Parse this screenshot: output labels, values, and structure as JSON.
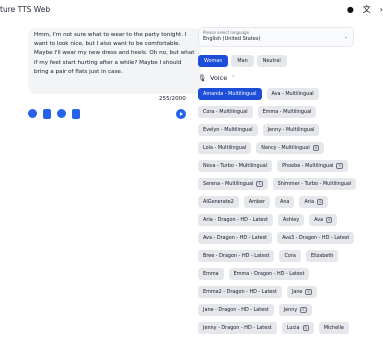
{
  "app": {
    "title": "ture TTS Web"
  },
  "editor": {
    "text": "Hmm, I'm not sure what to wear to the party tonight. I want to look nice, but I also want to be comfortable. Maybe I'll wear my new dress and heels. Oh no, but what if my feet start hurting after a while? Maybe I should bring a pair of flats just in case.",
    "char_count": "255/2000"
  },
  "language": {
    "label": "Please select language",
    "value": "English (United States)"
  },
  "gender_tabs": [
    "Woman",
    "Man",
    "Neutral"
  ],
  "voice_section": {
    "label": "Voice"
  },
  "voices": [
    [
      "Amanda - Multilingual",
      "Ava - Multilingual"
    ],
    [
      "Cora - Multilingual",
      "Emma - Multilingual"
    ],
    [
      "Evelyn - Multilingual",
      "Jenny - Multilingual"
    ],
    [
      "Lola - Multilingual",
      "Nancy - Multilingual"
    ],
    [
      "Nova - Turbo - Multilingual",
      "Phoebe - Multilingual"
    ],
    [
      "Serena - Multilingual",
      "Shimmer - Turbo - Multilingual"
    ],
    [
      "AIGenerate2",
      "Amber",
      "Ana",
      "Aria"
    ],
    [
      "Aria - Dragon - HD - Latest",
      "Ashley",
      "Ava"
    ],
    [
      "Ava - Dragon - HD - Latest",
      "Ava3 - Dragon - HD - Latest"
    ],
    [
      "Bree - Dragon - HD - Latest",
      "Cora",
      "Elizabeth"
    ],
    [
      "Emma",
      "Emma - Dragon - HD - Latest"
    ],
    [
      "Emma2 - Dragon - HD - Latest",
      "Jane"
    ],
    [
      "Jane - Dragon - HD - Latest",
      "Jenny"
    ],
    [
      "Jenny - Dragon - HD - Latest",
      "Lucia",
      "Michelle"
    ]
  ],
  "voice_badges": [
    "Nancy - Multilingual",
    "Phoebe - Multilingual",
    "Serena - Multilingual",
    "Aria",
    "Ava",
    "Jane",
    "Jenny",
    "Lucia"
  ],
  "selected": {
    "gender": "Woman",
    "voice": "Amanda - Multilingual"
  },
  "colors": {
    "accent": "#1d4ed8",
    "chip_bg": "#e5e7eb",
    "textarea_bg": "#f3f4f6"
  }
}
